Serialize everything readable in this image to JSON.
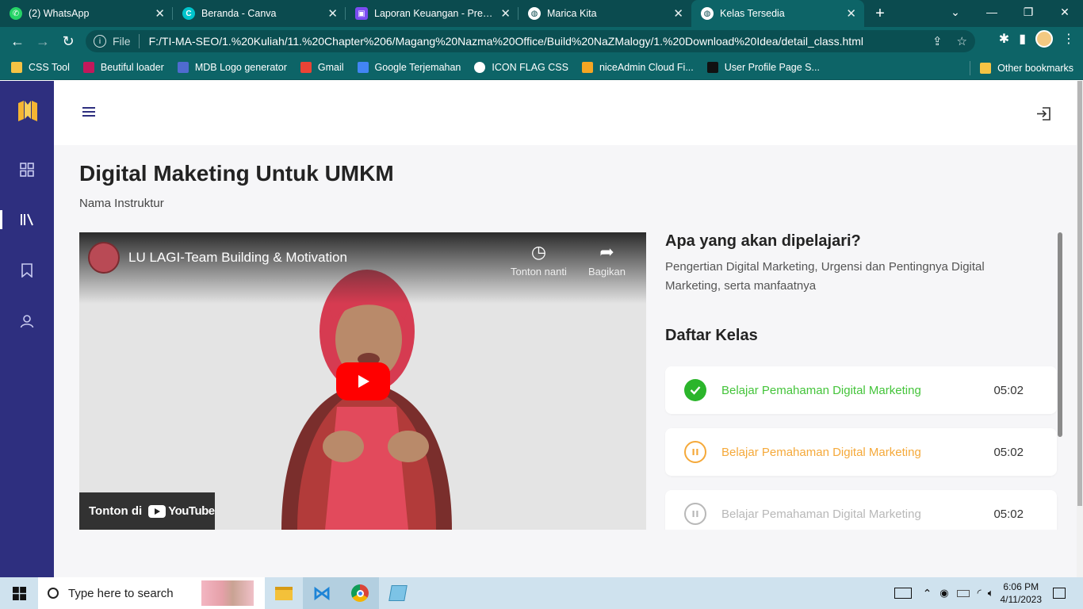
{
  "browser": {
    "tabs": [
      {
        "title": "(2) WhatsApp",
        "icon": "whatsapp-icon",
        "color": "#25d366"
      },
      {
        "title": "Beranda - Canva",
        "icon": "canva-icon",
        "color": "#00c4cc"
      },
      {
        "title": "Laporan Keuangan - Presenta",
        "icon": "slides-icon",
        "color": "#7b4cf2"
      },
      {
        "title": "Marica Kita",
        "icon": "globe-icon",
        "color": "#ffffff"
      },
      {
        "title": "Kelas Tersedia",
        "icon": "globe-icon",
        "color": "#ffffff"
      }
    ],
    "active_tab": 4,
    "new_tab": "+",
    "address": {
      "scheme_label": "File",
      "url": "F:/TI-MA-SEO/1.%20Kuliah/11.%20Chapter%206/Magang%20Nazma%20Office/Build%20NaZMalogy/1.%20Download%20Idea/detail_class.html"
    },
    "bookmarks": [
      {
        "label": "CSS Tool",
        "color": "#f6c344"
      },
      {
        "label": "Beutiful loader",
        "color": "#c2185b"
      },
      {
        "label": "MDB Logo generator",
        "color": "#4f6bd0"
      },
      {
        "label": "Gmail",
        "color": "#ea4335"
      },
      {
        "label": "Google Terjemahan",
        "color": "#4285f4"
      },
      {
        "label": "ICON FLAG CSS",
        "color": "#ffffff"
      },
      {
        "label": "niceAdmin Cloud Fi...",
        "color": "#f5a623"
      },
      {
        "label": "User Profile Page S...",
        "color": "#111111"
      }
    ],
    "other_bookmarks": "Other bookmarks"
  },
  "app": {
    "accent": "#2e2f7f",
    "sidebar": {
      "items": [
        {
          "name": "dashboard-icon"
        },
        {
          "name": "library-icon"
        },
        {
          "name": "bookmark-icon"
        },
        {
          "name": "user-icon"
        }
      ],
      "active_index": 1
    },
    "page": {
      "title": "Digital Maketing Untuk UMKM",
      "instructor": "Nama Instruktur"
    },
    "video": {
      "title": "LU LAGI-Team Building & Motivation",
      "watch_later": "Tonton nanti",
      "share": "Bagikan",
      "watch_on": "Tonton di",
      "youtube": "YouTube"
    },
    "learn": {
      "heading": "Apa yang akan dipelajari?",
      "description": "Pengertian Digital Marketing, Urgensi dan Pentingnya Digital Marketing, serta manfaatnya"
    },
    "classes": {
      "heading": "Daftar Kelas",
      "items": [
        {
          "title": "Belajar Pemahaman Digital Marketing",
          "duration": "05:02",
          "status": "completed",
          "color": "#44c43a"
        },
        {
          "title": "Belajar Pemahaman Digital Marketing",
          "duration": "05:02",
          "status": "in-progress",
          "color": "#f5a93a"
        },
        {
          "title": "Belajar Pemahaman Digital Marketing",
          "duration": "05:02",
          "status": "locked",
          "color": "#b8b8b8"
        }
      ]
    }
  },
  "taskbar": {
    "search_placeholder": "Type here to search",
    "time": "6:06 PM",
    "date": "4/11/2023"
  }
}
